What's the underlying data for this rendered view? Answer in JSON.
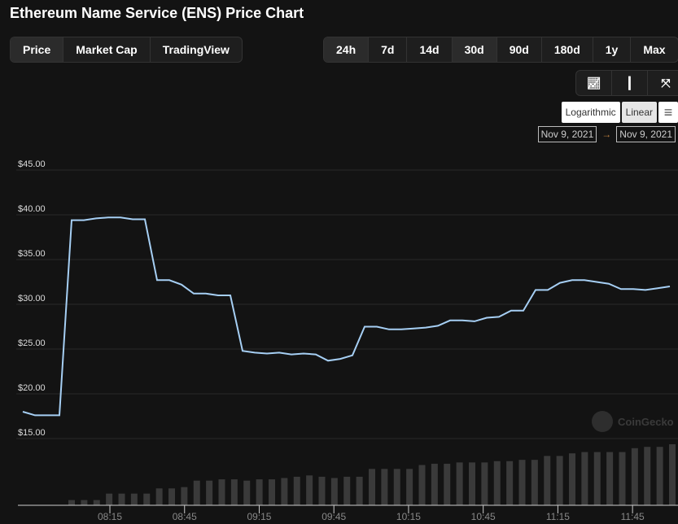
{
  "title": "Ethereum Name Service (ENS) Price Chart",
  "chart_tabs": [
    {
      "label": "Price",
      "active": true
    },
    {
      "label": "Market Cap"
    },
    {
      "label": "TradingView"
    }
  ],
  "range_tabs": [
    {
      "label": "24h",
      "active": true
    },
    {
      "label": "7d"
    },
    {
      "label": "14d"
    },
    {
      "label": "30d",
      "active": true
    },
    {
      "label": "90d"
    },
    {
      "label": "180d"
    },
    {
      "label": "1y"
    },
    {
      "label": "Max"
    }
  ],
  "scale": {
    "log": "Logarithmic",
    "linear": "Linear",
    "menu": "≡"
  },
  "dates": {
    "from": "Nov 9, 2021",
    "arrow": "→",
    "to": "Nov 9, 2021"
  },
  "watermark": "CoinGecko",
  "colors": {
    "line": "#a6cff4",
    "volume": "#3a3a3a"
  },
  "chart_data": {
    "type": "line",
    "title": "Ethereum Name Service (ENS) Price Chart",
    "ylim": [
      15,
      45
    ],
    "y_ticks": [
      "$15.00",
      "$20.00",
      "$25.00",
      "$30.00",
      "$35.00",
      "$40.00",
      "$45.00"
    ],
    "x_range_minutes": [
      460,
      720
    ],
    "x_ticks": [
      {
        "label": "08:15",
        "min": 495
      },
      {
        "label": "08:45",
        "min": 525
      },
      {
        "label": "09:15",
        "min": 555
      },
      {
        "label": "09:45",
        "min": 585
      },
      {
        "label": "10:15",
        "min": 615
      },
      {
        "label": "10:45",
        "min": 645
      },
      {
        "label": "11:15",
        "min": 675
      },
      {
        "label": "11:45",
        "min": 705
      }
    ],
    "price": [
      18.0,
      17.6,
      17.6,
      17.6,
      39.4,
      39.4,
      39.6,
      39.7,
      39.7,
      39.5,
      39.5,
      32.7,
      32.7,
      32.2,
      31.2,
      31.2,
      31.0,
      31.0,
      24.8,
      24.6,
      24.5,
      24.6,
      24.4,
      24.5,
      24.4,
      23.7,
      23.9,
      24.3,
      27.5,
      27.5,
      27.2,
      27.2,
      27.3,
      27.4,
      27.6,
      28.2,
      28.2,
      28.1,
      28.5,
      28.6,
      29.3,
      29.3,
      31.6,
      31.6,
      32.4,
      32.7,
      32.7,
      32.5,
      32.3,
      31.7,
      31.7,
      31.6,
      31.8,
      32.0
    ],
    "volume": [
      12,
      12,
      12,
      27,
      27,
      27,
      27,
      39,
      39,
      42,
      57,
      57,
      60,
      60,
      57,
      60,
      60,
      63,
      66,
      69,
      66,
      63,
      66,
      66,
      84,
      84,
      84,
      84,
      93,
      96,
      96,
      99,
      99,
      99,
      102,
      102,
      105,
      105,
      114,
      114,
      120,
      123,
      123,
      123,
      123,
      132,
      135,
      135,
      141
    ]
  }
}
